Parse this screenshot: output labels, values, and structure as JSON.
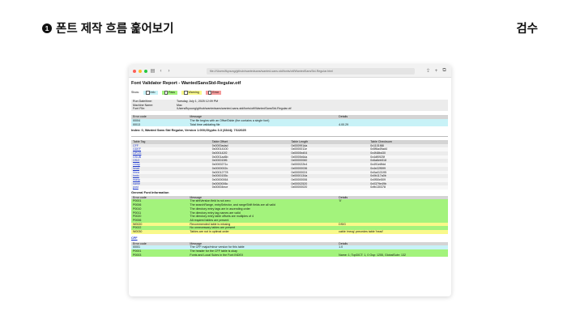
{
  "slide": {
    "number": "1",
    "title": "폰트 제작 흐름 훑어보기",
    "corner_label": "검수"
  },
  "browser": {
    "url": "file:///Users/fkyoung/github/wantedsans/wanted-sans-std/fonts/otf/WantedSansStd-Regular.html",
    "traffic_colors": [
      "#fe5f57",
      "#febc2e",
      "#28c840"
    ],
    "icons": [
      "sidebar-icon",
      "back-icon",
      "forward-icon",
      "share-icon",
      "new-tab-icon",
      "tabs-icon"
    ]
  },
  "report": {
    "title": "Font Validator Report - WantedSansStd-Regular.otf",
    "show_label": "Show:",
    "show_filters": [
      {
        "label": "Info",
        "color": "#c8f2f7"
      },
      {
        "label": "Pass",
        "color": "#a3f37c"
      },
      {
        "label": "Warning",
        "color": "#f9f98a"
      },
      {
        "label": "Error",
        "color": "#f59a9a"
      }
    ],
    "meta": [
      {
        "label": "Run Date/time:",
        "value": "Tuesday, July 1, 2025 12:09 PM"
      },
      {
        "label": "Machine Name:",
        "value": "Mac"
      },
      {
        "label": "Font File:",
        "value": "/Users/fkyoung/github/wantedsans/wanted-sans-std/fonts/otf/WantedSansStd-Regular.otf"
      }
    ],
    "summary_headers": [
      "Error code",
      "Message",
      "Details"
    ],
    "summary_rows": [
      {
        "code": "I0004",
        "message": "The file begins with an OffsetTable (the contains a single font)",
        "details": "",
        "type": "info"
      },
      {
        "code": "I0013",
        "message": "Total time validating file",
        "details": "4.00.29",
        "type": "info"
      }
    ],
    "font_index_line": "Index: 0, Wanted Sans Std Regular, Version 1.000;Glyphs 3.3 (3344); 7/1/2025",
    "tag_headers": [
      "Table Tag",
      "Table Offset",
      "Table Length",
      "Table Checksum"
    ],
    "tag_rows": [
      [
        "CFF ",
        "0x0000adad",
        "0x000991da",
        "0x1101f88"
      ],
      [
        "GDEF",
        "0x00014100",
        "0x0000011e",
        "0x5f6a49ad4"
      ],
      [
        "GPOS",
        "0x000142f2",
        "0x0000bd04",
        "0x4f48bd30"
      ],
      [
        "GSUB",
        "0x0001ad6b",
        "0x0000b6da",
        "0x4df0925f"
      ],
      [
        "OS/2",
        "0x000015f6",
        "0x00000060",
        "0x6a6eb518"
      ],
      [
        "cmap",
        "0x0000271c",
        "0x000022b4",
        "0x491e8fdd"
      ],
      [
        "head",
        "0x0000002c",
        "0x00000036",
        "0x4e22f599"
      ],
      [
        "hhea",
        "0x00012778",
        "0x00000024",
        "0x0a413195"
      ],
      [
        "hmtx",
        "0x0000155c",
        "0x0000134a",
        "0x0b117a0b"
      ],
      [
        "maxp",
        "0x00000064",
        "0x00000006",
        "0x0f50e509"
      ],
      [
        "name",
        "0x0000006c",
        "0x00002520",
        "0x0379e49b"
      ],
      [
        "post",
        "0x00004ece",
        "0x00000020",
        "0xfb130378"
      ]
    ],
    "general_title": "General Font Information",
    "general_headers": [
      "Error code",
      "Message",
      "Details"
    ],
    "general_rows": [
      {
        "code": "P0001",
        "message": "The sfntVersion field is not zero",
        "details": "'0'",
        "type": "pass"
      },
      {
        "code": "P0006",
        "message": "The searchRange, entrySelector, and rangeShift fields are all valid",
        "details": "",
        "type": "pass"
      },
      {
        "code": "P0010",
        "message": "The directory entry tags are in ascending order",
        "details": "",
        "type": "pass"
      },
      {
        "code": "P0011",
        "message": "The directory entry tag names are valid",
        "details": "",
        "type": "pass"
      },
      {
        "code": "P0020",
        "message": "The directory entry table offsets are multiples of 4",
        "details": "",
        "type": "pass"
      },
      {
        "code": "P0006",
        "message": "All required tables are present",
        "details": "",
        "type": "pass"
      },
      {
        "code": "W0020",
        "message": "Recommended table is missing",
        "details": "DSIG",
        "type": "warn"
      },
      {
        "code": "P0022",
        "message": "No unnecessary tables are present",
        "details": "",
        "type": "pass"
      },
      {
        "code": "W0030",
        "message": "Tables are not in optimal order",
        "details": "cable 'meog' precedes table 'head'",
        "type": "warn"
      }
    ],
    "cff_link": "CFF",
    "cff_headers": [
      "Error code",
      "Message",
      "Details"
    ],
    "cff_rows": [
      {
        "code": "I0001",
        "message": "The CFF major/minor version for this table",
        "details": "1.0",
        "type": "info"
      },
      {
        "code": "P0001",
        "message": "The header for the CFF table is okay",
        "details": "",
        "type": "pass"
      },
      {
        "code": "P0003",
        "message": "Fonts and Local Subrs in the Font INDEX",
        "details": "Name: 1; TopDICT: 1, 0 Gsp: 1255, GlobalSubr: 132",
        "type": "pass"
      }
    ]
  }
}
